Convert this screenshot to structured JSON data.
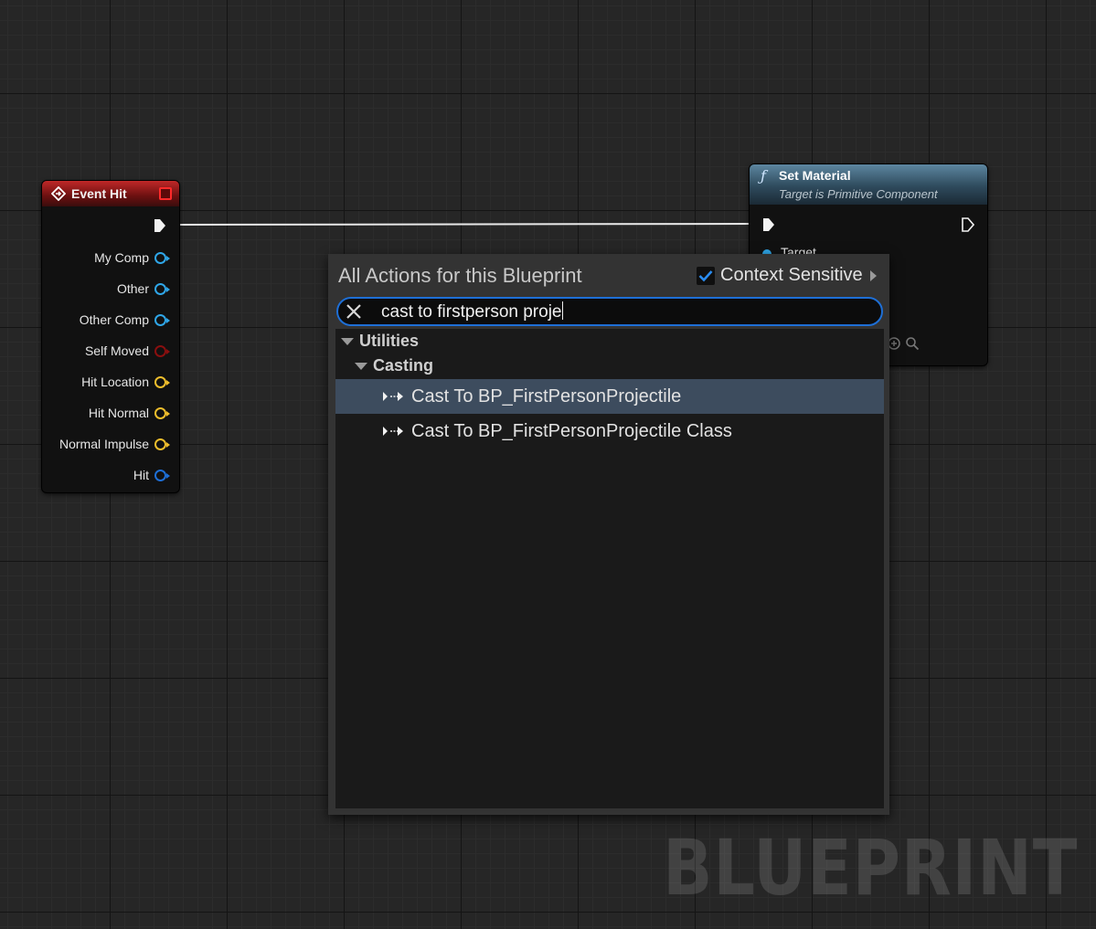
{
  "graph": {
    "watermark": "BLUEPRINT"
  },
  "event_node": {
    "title": "Event Hit",
    "pins": [
      {
        "label": "My Comp",
        "color": "#2fa6e8"
      },
      {
        "label": "Other",
        "color": "#2fa6e8"
      },
      {
        "label": "Other Comp",
        "color": "#2fa6e8"
      },
      {
        "label": "Self Moved",
        "color": "#8a0f0f"
      },
      {
        "label": "Hit Location",
        "color": "#f0be2c"
      },
      {
        "label": "Hit Normal",
        "color": "#f0be2c"
      },
      {
        "label": "Normal Impulse",
        "color": "#f0be2c"
      },
      {
        "label": "Hit",
        "color": "#1e6fd6"
      }
    ]
  },
  "function_node": {
    "title": "Set Material",
    "subtitle": "Target is Primitive Component",
    "target_label": "Target"
  },
  "action_menu": {
    "title": "All Actions for this Blueprint",
    "context_sensitive_label": "Context Sensitive",
    "context_sensitive_checked": true,
    "search_value": "cast to firstperson proje",
    "categories": [
      {
        "label": "Utilities"
      },
      {
        "label": "Casting"
      }
    ],
    "items": [
      {
        "label": "Cast To BP_FirstPersonProjectile",
        "selected": true
      },
      {
        "label": "Cast To BP_FirstPersonProjectile Class",
        "selected": false
      }
    ],
    "accent_color": "#1e6fd6"
  }
}
